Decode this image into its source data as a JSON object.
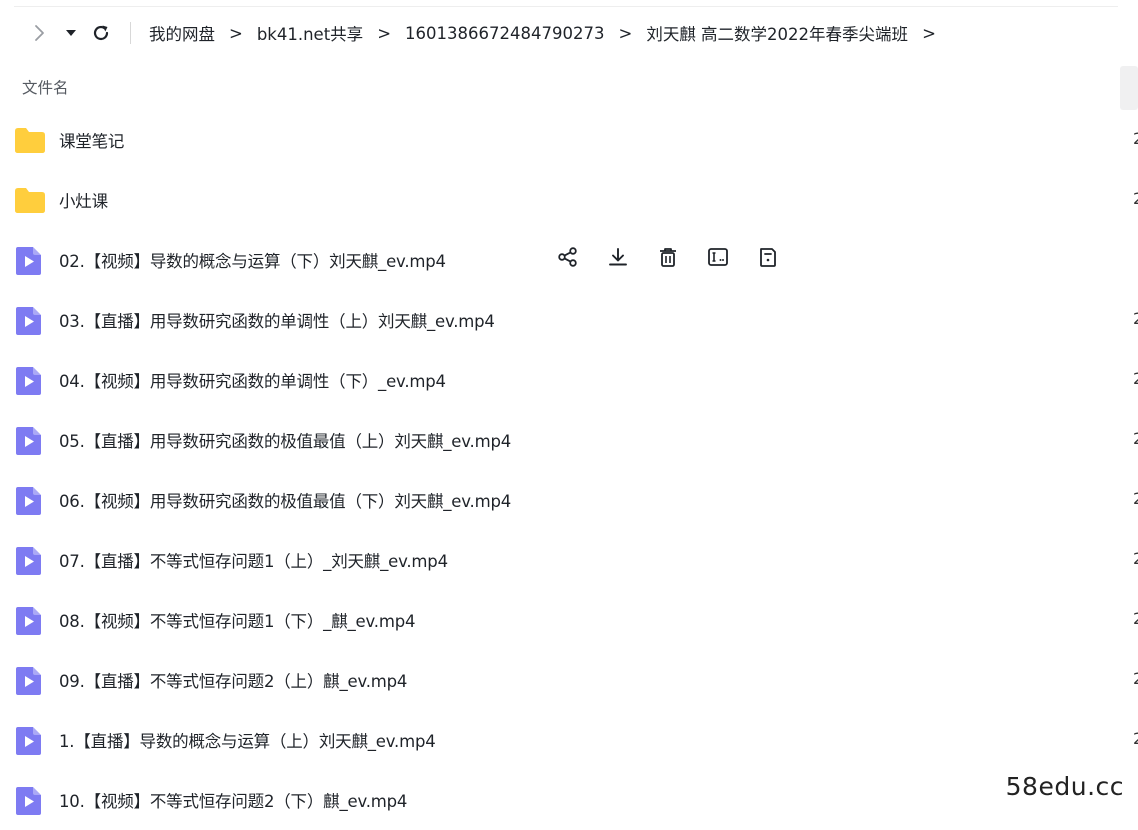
{
  "breadcrumbs": [
    "我的网盘",
    "bk41.net共享",
    "1601386672484790273",
    "刘天麒 高二数学2022年春季尖端班"
  ],
  "breadcrumb_separator": ">",
  "column_header": "文件名",
  "files": [
    {
      "name": "课堂笔记",
      "type": "folder",
      "meta": "2"
    },
    {
      "name": "小灶课",
      "type": "folder",
      "meta": "2"
    },
    {
      "name": "02.【视频】导数的概念与运算（下）刘天麒_ev.mp4",
      "type": "video",
      "meta": ""
    },
    {
      "name": "03.【直播】用导数研究函数的单调性（上）刘天麒_ev.mp4",
      "type": "video",
      "meta": "2"
    },
    {
      "name": "04.【视频】用导数研究函数的单调性（下）_ev.mp4",
      "type": "video",
      "meta": "2"
    },
    {
      "name": "05.【直播】用导数研究函数的极值最值（上）刘天麒_ev.mp4",
      "type": "video",
      "meta": "2"
    },
    {
      "name": "06.【视频】用导数研究函数的极值最值（下）刘天麒_ev.mp4",
      "type": "video",
      "meta": "2"
    },
    {
      "name": "07.【直播】不等式恒存问题1（上）_刘天麒_ev.mp4",
      "type": "video",
      "meta": "2"
    },
    {
      "name": "08.【视频】不等式恒存问题1（下）_麒_ev.mp4",
      "type": "video",
      "meta": "2"
    },
    {
      "name": "09.【直播】不等式恒存问题2（上）麒_ev.mp4",
      "type": "video",
      "meta": "2"
    },
    {
      "name": "1.【直播】导数的概念与运算（上）刘天麒_ev.mp4",
      "type": "video",
      "meta": "2"
    },
    {
      "name": "10.【视频】不等式恒存问题2（下）麒_ev.mp4",
      "type": "video",
      "meta": ""
    }
  ],
  "hover_row_actions": [
    "share-icon",
    "download-icon",
    "delete-icon",
    "rename-icon",
    "more-info-icon"
  ],
  "colors": {
    "folder": "#FFCE3D",
    "video": "#7E7BF2",
    "text": "#1f2329",
    "muted": "#555a61"
  },
  "watermark": "58edu.cc"
}
